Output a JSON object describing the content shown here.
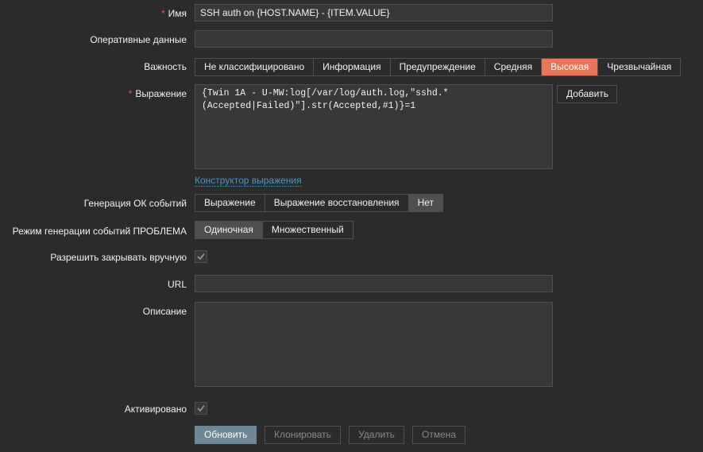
{
  "form": {
    "name": {
      "label": "Имя",
      "value": "SSH auth on {HOST.NAME} - {ITEM.VALUE}"
    },
    "opdata": {
      "label": "Оперативные данные",
      "value": ""
    },
    "severity": {
      "label": "Важность",
      "options": [
        "Не классифицировано",
        "Информация",
        "Предупреждение",
        "Средняя",
        "Высокая",
        "Чрезвычайная"
      ],
      "selected": "Высокая",
      "selected_color": "#e97659"
    },
    "expression": {
      "label": "Выражение",
      "value": "{Twin 1A - U-MW:log[/var/log/auth.log,\"sshd.*(Accepted|Failed)\"].str(Accepted,#1)}=1",
      "add_button": "Добавить",
      "constructor_link": "Конструктор выражения"
    },
    "ok_event": {
      "label": "Генерация ОК событий",
      "options": [
        "Выражение",
        "Выражение восстановления",
        "Нет"
      ],
      "selected": "Нет"
    },
    "problem_mode": {
      "label": "Режим генерации событий ПРОБЛЕМА",
      "options": [
        "Одиночная",
        "Множественный"
      ],
      "selected": "Одиночная"
    },
    "manual_close": {
      "label": "Разрешить закрывать вручную",
      "checked": true
    },
    "url": {
      "label": "URL",
      "value": ""
    },
    "description": {
      "label": "Описание",
      "value": ""
    },
    "enabled": {
      "label": "Активировано",
      "checked": true
    }
  },
  "actions": {
    "update": "Обновить",
    "clone": "Клонировать",
    "delete": "Удалить",
    "cancel": "Отмена"
  },
  "colors": {
    "background": "#2b2b2b",
    "primary": "#6d8796",
    "link": "#4796c4",
    "required": "#e45959"
  }
}
